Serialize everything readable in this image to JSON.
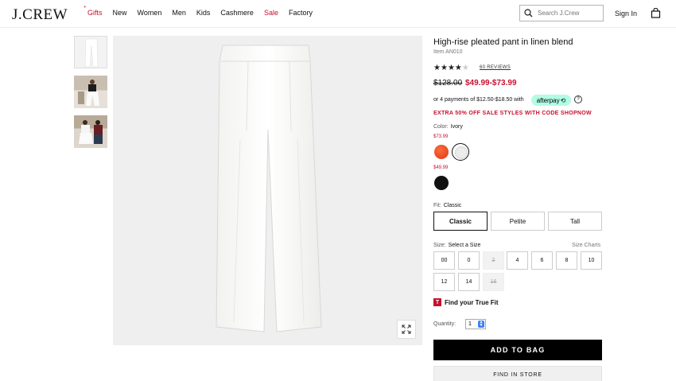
{
  "header": {
    "logo": "J.CREW",
    "nav": [
      "Gifts",
      "New",
      "Women",
      "Men",
      "Kids",
      "Cashmere",
      "Sale",
      "Factory"
    ],
    "gifts_star": "*",
    "search_placeholder": "Search J.Crew",
    "sign_in": "Sign In"
  },
  "product": {
    "title": "High-rise pleated pant in linen blend",
    "item": "Item AN010",
    "rating": 4,
    "reviews": "60 REVIEWS",
    "price_old": "$128.00",
    "price_new": "$49.99-$73.99",
    "afterpay_text": "or 4 payments of $12.50-$18.50 with",
    "afterpay_brand": "afterpay",
    "promo": "EXTRA 50% OFF SALE STYLES WITH CODE SHOPNOW",
    "color_label": "Color:",
    "color_value": "Ivory",
    "price_group_a": "$73.99",
    "price_group_b": "$49.99",
    "fit_label": "Fit:",
    "fit_value": "Classic",
    "fits": [
      "Classic",
      "Petite",
      "Tall"
    ],
    "size_label": "Size:",
    "size_value": "Select a Size",
    "size_charts": "Size Charts",
    "sizes": [
      "00",
      "0",
      "2",
      "4",
      "6",
      "8",
      "10",
      "12",
      "14",
      "16"
    ],
    "truefit_icon": "T",
    "truefit": "Find your True Fit",
    "quantity_label": "Quantity:",
    "quantity": "1",
    "add_to_bag": "ADD TO BAG",
    "find_in_store": "FIND IN STORE"
  },
  "colors": {
    "accent_red": "#c8102e",
    "swatches": [
      "#e84a22",
      "#ececec",
      "#111111"
    ]
  }
}
